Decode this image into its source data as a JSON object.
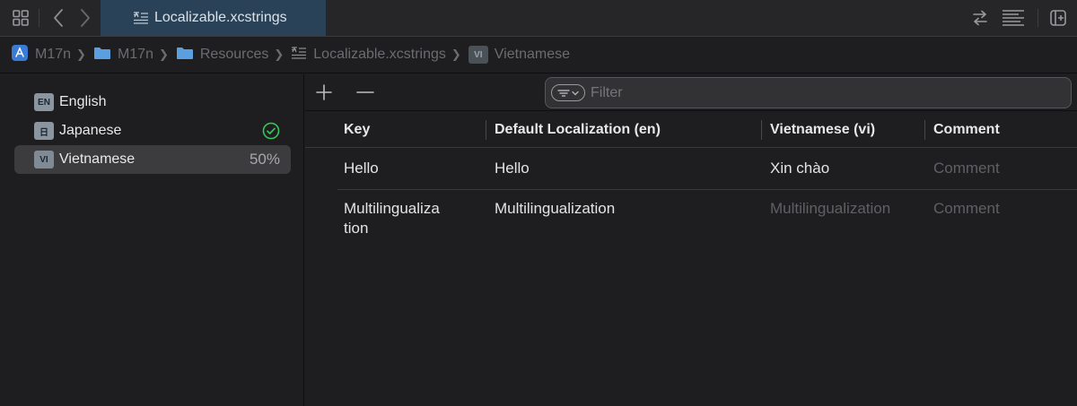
{
  "tabbar": {
    "active_tab": "Localizable.xcstrings"
  },
  "breadcrumb": [
    {
      "label": "M17n",
      "icon": "app-icon"
    },
    {
      "label": "M17n",
      "icon": "folder-icon"
    },
    {
      "label": "Resources",
      "icon": "folder-icon"
    },
    {
      "label": "Localizable.xcstrings",
      "icon": "strings-file-icon"
    },
    {
      "label": "Vietnamese",
      "badge": "VI"
    }
  ],
  "sidebar": {
    "languages": [
      {
        "badge": "EN",
        "label": "English",
        "status": ""
      },
      {
        "badge": "日",
        "label": "Japanese",
        "status": "check"
      },
      {
        "badge": "VI",
        "label": "Vietnamese",
        "status": "50%"
      }
    ]
  },
  "toolbar": {
    "add": "+",
    "remove": "—",
    "filter_placeholder": "Filter"
  },
  "table": {
    "columns": [
      "Key",
      "Default Localization (en)",
      "Vietnamese (vi)",
      "Comment"
    ],
    "rows": [
      {
        "key": "Hello",
        "default": "Hello",
        "translation": "Xin chào",
        "translation_placeholder": false,
        "comment": "Comment"
      },
      {
        "key": "Multilingualiza\ntion",
        "default": "Multilingualization",
        "translation": "Multilingualization",
        "translation_placeholder": true,
        "comment": "Comment"
      }
    ]
  },
  "colors": {
    "accent_tab": "#2a4257",
    "check_green": "#34c759",
    "app_icon_blue": "#3a7bd5",
    "folder_blue": "#5aa0e0"
  }
}
